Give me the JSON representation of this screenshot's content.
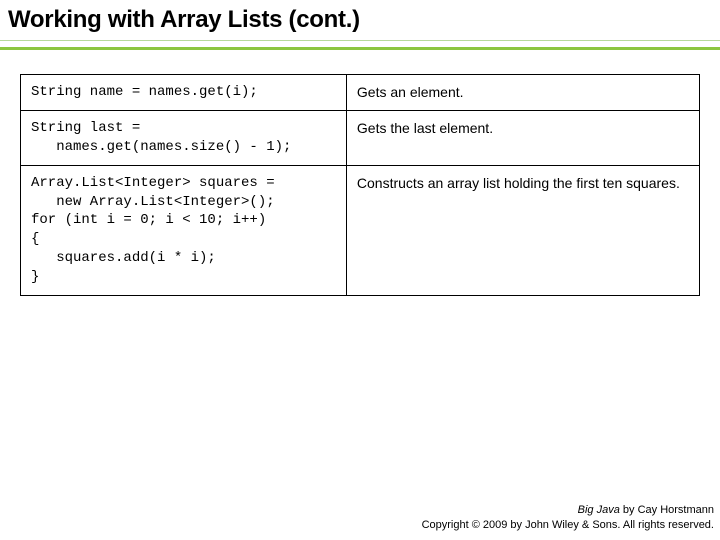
{
  "title": "Working with Array Lists (cont.)",
  "rows": [
    {
      "code": "String name = names.get(i);",
      "desc": "Gets an element."
    },
    {
      "code": "String last =\n   names.get(names.size() - 1);",
      "desc": "Gets the last element."
    },
    {
      "code": "Array.List<Integer> squares =\n   new Array.List<Integer>();\nfor (int i = 0; i < 10; i++)\n{\n   squares.add(i * i);\n}",
      "desc": "Constructs an array list holding the first ten squares."
    }
  ],
  "footer": {
    "book": "Big Java",
    "author": " by Cay Horstmann",
    "copyright": "Copyright © 2009 by John Wiley & Sons.  All rights reserved."
  }
}
